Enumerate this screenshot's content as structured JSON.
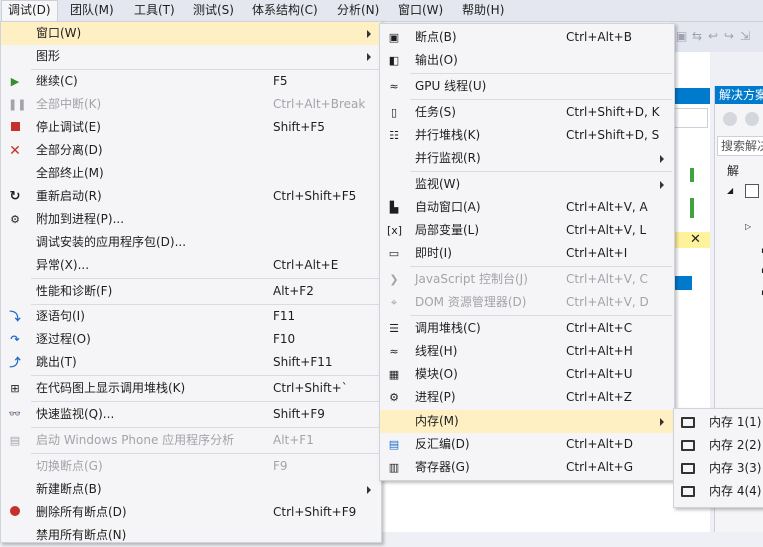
{
  "menubar": {
    "items": [
      "调试(D)",
      "团队(M)",
      "工具(T)",
      "测试(S)",
      "体系结构(C)",
      "分析(N)",
      "窗口(W)",
      "帮助(H)"
    ]
  },
  "background": {
    "solution_explorer_title": "解决方案",
    "search_placeholder": "搜索解决",
    "tree_item": "解"
  },
  "debug_menu": {
    "items": [
      {
        "label": "窗口(W)",
        "shortcut": "",
        "icon": "none",
        "submenu": true,
        "highlighted": true
      },
      {
        "label": "图形",
        "shortcut": "",
        "icon": "none",
        "submenu": true
      },
      {
        "label": "继续(C)",
        "shortcut": "F5",
        "icon": "play-icon"
      },
      {
        "label": "全部中断(K)",
        "shortcut": "Ctrl+Alt+Break",
        "icon": "pause-icon",
        "disabled": true
      },
      {
        "label": "停止调试(E)",
        "shortcut": "Shift+F5",
        "icon": "stop-icon"
      },
      {
        "label": "全部分离(D)",
        "shortcut": "",
        "icon": "detach-icon"
      },
      {
        "label": "全部终止(M)",
        "shortcut": "",
        "icon": "none"
      },
      {
        "label": "重新启动(R)",
        "shortcut": "Ctrl+Shift+F5",
        "icon": "restart-icon"
      },
      {
        "label": "附加到进程(P)...",
        "shortcut": "",
        "icon": "attach-process-icon"
      },
      {
        "label": "调试安装的应用程序包(D)...",
        "shortcut": "",
        "icon": "none"
      },
      {
        "label": "异常(X)...",
        "shortcut": "Ctrl+Alt+E",
        "icon": "none"
      },
      {
        "label": "性能和诊断(F)",
        "shortcut": "Alt+F2",
        "icon": "none"
      },
      {
        "label": "逐语句(I)",
        "shortcut": "F11",
        "icon": "step-into-icon"
      },
      {
        "label": "逐过程(O)",
        "shortcut": "F10",
        "icon": "step-over-icon"
      },
      {
        "label": "跳出(T)",
        "shortcut": "Shift+F11",
        "icon": "step-out-icon"
      },
      {
        "label": "在代码图上显示调用堆栈(K)",
        "shortcut": "Ctrl+Shift+`",
        "icon": "code-map-icon"
      },
      {
        "label": "快速监视(Q)...",
        "shortcut": "Shift+F9",
        "icon": "quickwatch-icon"
      },
      {
        "label": "启动 Windows Phone 应用程序分析",
        "shortcut": "Alt+F1",
        "icon": "phone-analysis-icon",
        "disabled": true
      },
      {
        "label": "切换断点(G)",
        "shortcut": "F9",
        "icon": "none",
        "disabled": true
      },
      {
        "label": "新建断点(B)",
        "shortcut": "",
        "icon": "none",
        "submenu": true
      },
      {
        "label": "删除所有断点(D)",
        "shortcut": "Ctrl+Shift+F9",
        "icon": "delete-breakpoints-icon"
      },
      {
        "label": "禁用所有断点(N)",
        "shortcut": "",
        "icon": "none"
      }
    ]
  },
  "window_submenu": {
    "items": [
      {
        "label": "断点(B)",
        "shortcut": "Ctrl+Alt+B",
        "icon": "breakpoints-icon"
      },
      {
        "label": "输出(O)",
        "shortcut": "",
        "icon": "output-icon"
      },
      {
        "label": "GPU 线程(U)",
        "shortcut": "",
        "icon": "gpu-threads-icon"
      },
      {
        "label": "任务(S)",
        "shortcut": "Ctrl+Shift+D, K",
        "icon": "tasks-icon"
      },
      {
        "label": "并行堆栈(K)",
        "shortcut": "Ctrl+Shift+D, S",
        "icon": "parallel-stacks-icon"
      },
      {
        "label": "并行监视(R)",
        "shortcut": "",
        "icon": "none",
        "submenu": true
      },
      {
        "label": "监视(W)",
        "shortcut": "",
        "icon": "none",
        "submenu": true
      },
      {
        "label": "自动窗口(A)",
        "shortcut": "Ctrl+Alt+V, A",
        "icon": "autos-icon"
      },
      {
        "label": "局部变量(L)",
        "shortcut": "Ctrl+Alt+V, L",
        "icon": "locals-icon"
      },
      {
        "label": "即时(I)",
        "shortcut": "Ctrl+Alt+I",
        "icon": "immediate-icon"
      },
      {
        "label": "JavaScript 控制台(J)",
        "shortcut": "Ctrl+Alt+V, C",
        "icon": "js-console-icon",
        "disabled": true
      },
      {
        "label": "DOM 资源管理器(D)",
        "shortcut": "Ctrl+Alt+V, D",
        "icon": "dom-explorer-icon",
        "disabled": true
      },
      {
        "label": "调用堆栈(C)",
        "shortcut": "Ctrl+Alt+C",
        "icon": "call-stack-icon"
      },
      {
        "label": "线程(H)",
        "shortcut": "Ctrl+Alt+H",
        "icon": "threads-icon"
      },
      {
        "label": "模块(O)",
        "shortcut": "Ctrl+Alt+U",
        "icon": "modules-icon"
      },
      {
        "label": "进程(P)",
        "shortcut": "Ctrl+Alt+Z",
        "icon": "processes-icon"
      },
      {
        "label": "内存(M)",
        "shortcut": "",
        "icon": "none",
        "submenu": true,
        "highlighted": true
      },
      {
        "label": "反汇编(D)",
        "shortcut": "Ctrl+Alt+D",
        "icon": "disassembly-icon"
      },
      {
        "label": "寄存器(G)",
        "shortcut": "Ctrl+Alt+G",
        "icon": "registers-icon"
      }
    ]
  },
  "memory_submenu": {
    "items": [
      {
        "label": "内存 1(1)",
        "icon": "memory-chip-icon"
      },
      {
        "label": "内存 2(2)",
        "icon": "memory-chip-icon"
      },
      {
        "label": "内存 3(3)",
        "icon": "memory-chip-icon"
      },
      {
        "label": "内存 4(4)",
        "icon": "memory-chip-icon"
      }
    ]
  },
  "colors": {
    "highlight": "#fff0c4",
    "menu_bg": "#f5f5f7",
    "accent_blue": "#007acc",
    "continue_green": "#388a34",
    "stop_red": "#c5302a"
  }
}
